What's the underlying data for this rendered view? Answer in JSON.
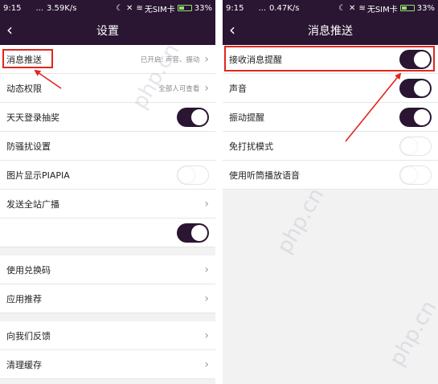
{
  "left": {
    "status": {
      "time": "9:15",
      "speed": "3.59K/s",
      "carrier": "无SIM卡",
      "battery": "33%"
    },
    "title": "设置",
    "rows": [
      {
        "label": "消息推送",
        "value": "已开启: 声音、振动"
      },
      {
        "label": "动态权限",
        "value": "全部人可查看"
      },
      {
        "label": "天天登录抽奖"
      },
      {
        "label": "防骚扰设置"
      },
      {
        "label": "图片显示PIAPIA"
      },
      {
        "label": "发送全站广播"
      },
      {
        "label": ""
      },
      {
        "label": "使用兑换码"
      },
      {
        "label": "应用推荐"
      },
      {
        "label": "向我们反馈"
      },
      {
        "label": "清理缓存"
      }
    ]
  },
  "right": {
    "status": {
      "time": "9:15",
      "speed": "0.47K/s",
      "carrier": "无SIM卡",
      "battery": "33%"
    },
    "title": "消息推送",
    "rows": [
      {
        "label": "接收消息提醒",
        "toggle": "on"
      },
      {
        "label": "声音",
        "toggle": "on"
      },
      {
        "label": "振动提醒",
        "toggle": "on"
      },
      {
        "label": "免打扰模式",
        "toggle": "off"
      },
      {
        "label": "使用听筒播放语音"
      }
    ]
  },
  "watermark": "php.cn",
  "colors": {
    "bar": "#2a1532",
    "annotation": "#e0261e",
    "battery": "#8fe36b"
  }
}
